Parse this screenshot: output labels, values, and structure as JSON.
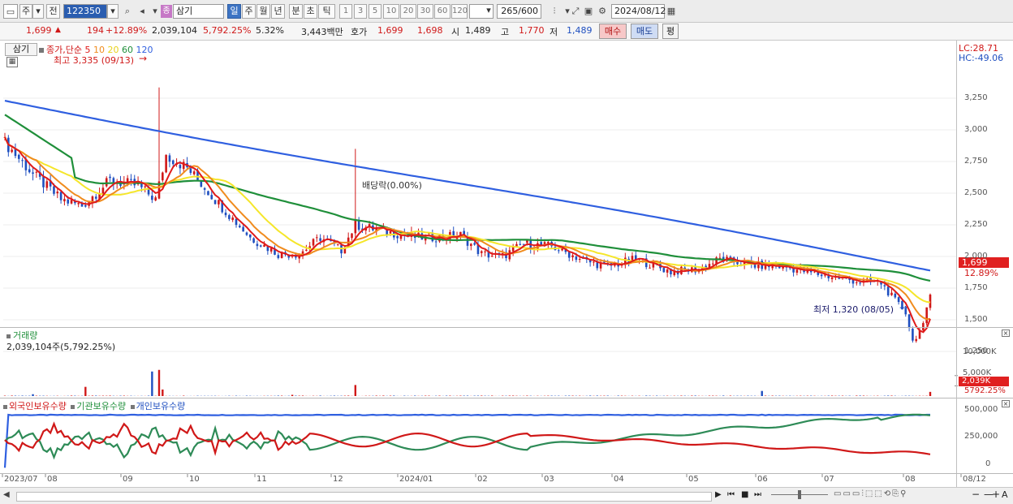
{
  "toolbar": {
    "market_type": "주",
    "prefix": "전",
    "code": "122350",
    "name_badge": "종",
    "name": "삼기",
    "periods": [
      "일",
      "주",
      "월",
      "년",
      "분",
      "초",
      "틱"
    ],
    "intervals": [
      "1",
      "3",
      "5",
      "10",
      "20",
      "30",
      "60",
      "120"
    ],
    "count": "265",
    "count_max": "/600",
    "date": "2024/08/12"
  },
  "quote": {
    "price": "1,699",
    "change_arrow": "▲",
    "change": "194",
    "change_pct": "+12.89%",
    "volume": "2,039,104",
    "volume_pct": "5,792.25%",
    "turnover": "5.32%",
    "amount": "3,443백만",
    "hoga_label": "호가",
    "ask": "1,699",
    "bid": "1,698",
    "open_label": "시",
    "open": "1,489",
    "high_label": "고",
    "high": "1,770",
    "low_label": "저",
    "low": "1,489",
    "buy": "매수",
    "sell": "매도",
    "eval": "평"
  },
  "price_panel": {
    "name": "삼기",
    "ma_title": "종가,단순",
    "ma_periods": [
      "5",
      "10",
      "20",
      "60",
      "120"
    ],
    "max_label": "최고 3,335 (09/13)",
    "min_label": "최저 1,320 (08/05)",
    "dividend_label": "배당락(0.00%)",
    "lc": "LC:28.71",
    "hc": "HC:-49.06",
    "last_price": "1,699",
    "last_pct": "12.89%",
    "y_ticks": [
      "3,250",
      "3,000",
      "2,750",
      "2,500",
      "2,250",
      "2,000",
      "1,750",
      "1,500",
      "1,250"
    ]
  },
  "volume_panel": {
    "title": "거래량",
    "value": "2,039,104주(5,792.25%)",
    "y_ticks": [
      "10,000K",
      "5,000K"
    ],
    "last_vol": "2,039K",
    "last_pct": "5792.25%"
  },
  "holding_panel": {
    "legends": [
      "외국인보유수량",
      "기관보유수량",
      "개인보유수량"
    ],
    "y_ticks": [
      "500,000",
      "250,000",
      "0"
    ]
  },
  "x_axis": [
    "2023/07",
    "08",
    "09",
    "10",
    "11",
    "12",
    "2024/01",
    "02",
    "03",
    "04",
    "05",
    "06",
    "07",
    "08",
    "08/12"
  ],
  "colors": {
    "up": "#d01818",
    "down": "#1f4fc0",
    "ma5": "#e01a1a",
    "ma10": "#f08c1e",
    "ma20": "#f5e62a",
    "ma60": "#1f8f3a",
    "ma120": "#2f5fe0"
  }
}
